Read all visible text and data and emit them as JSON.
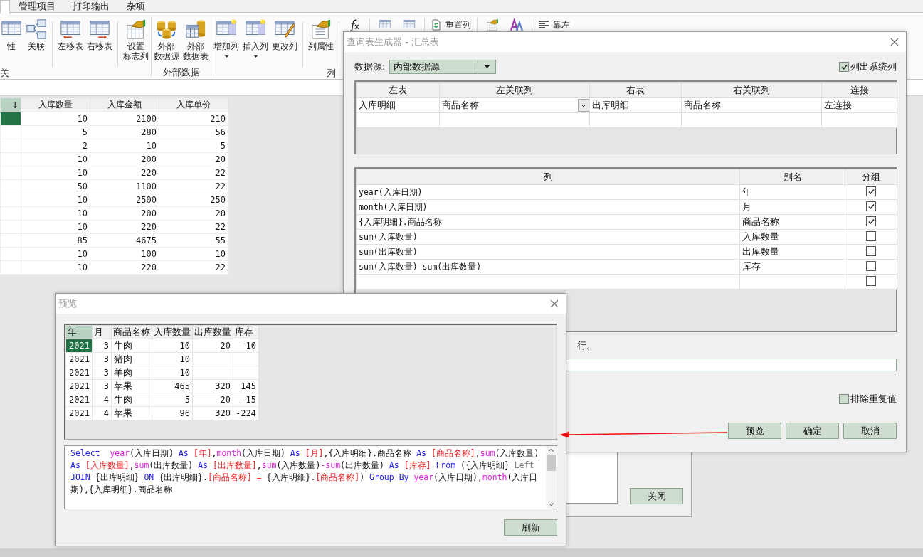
{
  "ribbon": {
    "tabs": [
      {
        "selected": true
      },
      {
        "label": "管理项目",
        "selected": false
      },
      {
        "label": "打印输出",
        "selected": false
      },
      {
        "label": "杂项",
        "selected": false
      }
    ],
    "groups": [
      {
        "label": "关",
        "sets": [
          [
            {
              "label": "性"
            },
            {
              "label": "关联"
            }
          ],
          [
            {
              "label": "左移表"
            },
            {
              "label": "右移表"
            }
          ],
          [
            {
              "label": "设置标志列"
            }
          ]
        ]
      },
      {
        "label": "外部数据",
        "sets": [
          [
            {
              "label": "外部数据源"
            },
            {
              "label": "外部数据表"
            }
          ]
        ]
      },
      {
        "label": "列",
        "sets": [
          [
            {
              "label": "增加列",
              "dropdown": true
            },
            {
              "label": "插入列",
              "dropdown": true
            },
            {
              "label": "更改列",
              "dropdown": false
            }
          ],
          [
            {
              "label": "列属性"
            }
          ]
        ]
      }
    ],
    "small_buttons": [
      "重置列",
      "靠左"
    ]
  },
  "grid": {
    "columns": [
      "↓",
      "入库数量",
      "入库金额",
      "入库单价"
    ],
    "rows": [
      {
        "selected": true,
        "cells": [
          "",
          "10",
          "2100",
          "210"
        ]
      },
      {
        "selected": false,
        "cells": [
          "",
          "5",
          "280",
          "56"
        ]
      },
      {
        "selected": false,
        "cells": [
          "",
          "2",
          "10",
          "5"
        ]
      },
      {
        "selected": false,
        "cells": [
          "",
          "10",
          "200",
          "20"
        ]
      },
      {
        "selected": false,
        "cells": [
          "",
          "10",
          "220",
          "22"
        ]
      },
      {
        "selected": false,
        "cells": [
          "",
          "50",
          "1100",
          "22"
        ]
      },
      {
        "selected": false,
        "cells": [
          "",
          "10",
          "2500",
          "250"
        ]
      },
      {
        "selected": false,
        "cells": [
          "",
          "10",
          "200",
          "20"
        ]
      },
      {
        "selected": false,
        "cells": [
          "",
          "10",
          "220",
          "22"
        ]
      },
      {
        "selected": false,
        "cells": [
          "",
          "85",
          "4675",
          "55"
        ]
      },
      {
        "selected": false,
        "cells": [
          "",
          "10",
          "100",
          "10"
        ]
      },
      {
        "selected": false,
        "cells": [
          "",
          "10",
          "220",
          "22"
        ]
      }
    ]
  },
  "back_window": {
    "buttons": [
      "关闭"
    ]
  },
  "query_dialog": {
    "title": "查询表生成器 - 汇总表",
    "data_source": {
      "label": "数据源:",
      "value": "内部数据源"
    },
    "show_system_columns": {
      "label": "列出系统列",
      "checked": true
    },
    "joins": {
      "columns": [
        "左表",
        "左关联列",
        "右表",
        "右关联列",
        "连接"
      ],
      "rows": [
        [
          "入库明细",
          "商品名称",
          "出库明细",
          "商品名称",
          "左连接"
        ]
      ]
    },
    "fields": {
      "columns": [
        "列",
        "别名",
        "分组"
      ],
      "rows": [
        {
          "column": "year(入库日期)",
          "alias": "年",
          "grouped": true
        },
        {
          "column": "month(入库日期)",
          "alias": "月",
          "grouped": true
        },
        {
          "column": "{入库明细}.商品名称",
          "alias": "商品名称",
          "grouped": true
        },
        {
          "column": "sum(入库数量)",
          "alias": "入库数量",
          "grouped": false
        },
        {
          "column": "sum(出库数量)",
          "alias": "出库数量",
          "grouped": false
        },
        {
          "column": "sum(入库数量)-sum(出库数量)",
          "alias": "库存",
          "grouped": false
        },
        {
          "grouped": false
        }
      ]
    },
    "hint": "行。",
    "distinct": {
      "label": "排除重复值",
      "checked": false
    },
    "buttons": [
      "预览",
      "确定",
      "取消"
    ]
  },
  "preview_dialog": {
    "title": "预览",
    "columns": [
      "年",
      "月",
      "商品名称",
      "入库数量",
      "出库数量",
      "库存"
    ],
    "rows": [
      {
        "selected": true,
        "cells": [
          "2021",
          "3",
          "牛肉",
          "10",
          "20",
          "-10"
        ]
      },
      {
        "selected": false,
        "cells": [
          "2021",
          "3",
          "猪肉",
          "10",
          "",
          ""
        ]
      },
      {
        "selected": false,
        "cells": [
          "2021",
          "3",
          "羊肉",
          "10",
          "",
          ""
        ]
      },
      {
        "selected": false,
        "cells": [
          "2021",
          "3",
          "苹果",
          "465",
          "320",
          "145"
        ]
      },
      {
        "selected": false,
        "cells": [
          "2021",
          "4",
          "牛肉",
          "5",
          "20",
          "-15"
        ]
      },
      {
        "selected": false,
        "cells": [
          "2021",
          "4",
          "苹果",
          "96",
          "320",
          "-224"
        ]
      }
    ],
    "sql": [
      {
        "kind": "keyword",
        "text": "Select  "
      },
      {
        "kind": "function",
        "text": "year"
      },
      {
        "kind": "plain",
        "text": "(入库日期) "
      },
      {
        "kind": "keyword",
        "text": "As "
      },
      {
        "kind": "alias",
        "text": "[年]"
      },
      {
        "kind": "plain",
        "text": ","
      },
      {
        "kind": "function",
        "text": "month"
      },
      {
        "kind": "plain",
        "text": "(入库日期) "
      },
      {
        "kind": "keyword",
        "text": "As "
      },
      {
        "kind": "alias",
        "text": "[月]"
      },
      {
        "kind": "plain",
        "text": ",{入库明细}.商品名称 "
      },
      {
        "kind": "keyword",
        "text": "As "
      },
      {
        "kind": "alias",
        "text": "[商品名称]"
      },
      {
        "kind": "plain",
        "text": ","
      },
      {
        "kind": "function",
        "text": "sum"
      },
      {
        "kind": "plain",
        "text": "(入库数量) "
      },
      {
        "kind": "keyword",
        "text": "As "
      },
      {
        "kind": "alias",
        "text": "[入库数量]"
      },
      {
        "kind": "plain",
        "text": ","
      },
      {
        "kind": "function",
        "text": "sum"
      },
      {
        "kind": "plain",
        "text": "(出库数量) "
      },
      {
        "kind": "keyword",
        "text": "As "
      },
      {
        "kind": "alias",
        "text": "[出库数量]"
      },
      {
        "kind": "plain",
        "text": ","
      },
      {
        "kind": "function",
        "text": "sum"
      },
      {
        "kind": "plain",
        "text": "(入库数量)"
      },
      {
        "kind": "function",
        "text": "-sum"
      },
      {
        "kind": "plain",
        "text": "(出库数量) "
      },
      {
        "kind": "keyword",
        "text": "As "
      },
      {
        "kind": "alias",
        "text": "[库存] "
      },
      {
        "kind": "keyword",
        "text": "From "
      },
      {
        "kind": "plain",
        "text": "({入库明细} "
      },
      {
        "kind": "muted",
        "text": "Left "
      },
      {
        "kind": "keyword",
        "text": "JOIN "
      },
      {
        "kind": "plain",
        "text": "{出库明细} "
      },
      {
        "kind": "keyword",
        "text": "ON "
      },
      {
        "kind": "plain",
        "text": "{出库明细}."
      },
      {
        "kind": "alias",
        "text": "[商品名称] = "
      },
      {
        "kind": "plain",
        "text": "{入库明细}."
      },
      {
        "kind": "alias",
        "text": "[商品名称]"
      },
      {
        "kind": "plain",
        "text": ") "
      },
      {
        "kind": "keyword",
        "text": "Group By "
      },
      {
        "kind": "function",
        "text": "year"
      },
      {
        "kind": "plain",
        "text": "(入库日期),"
      },
      {
        "kind": "function",
        "text": "month"
      },
      {
        "kind": "plain",
        "text": "(入库日期),{入库明细}.商品名称"
      }
    ],
    "buttons": [
      "刷新"
    ]
  }
}
